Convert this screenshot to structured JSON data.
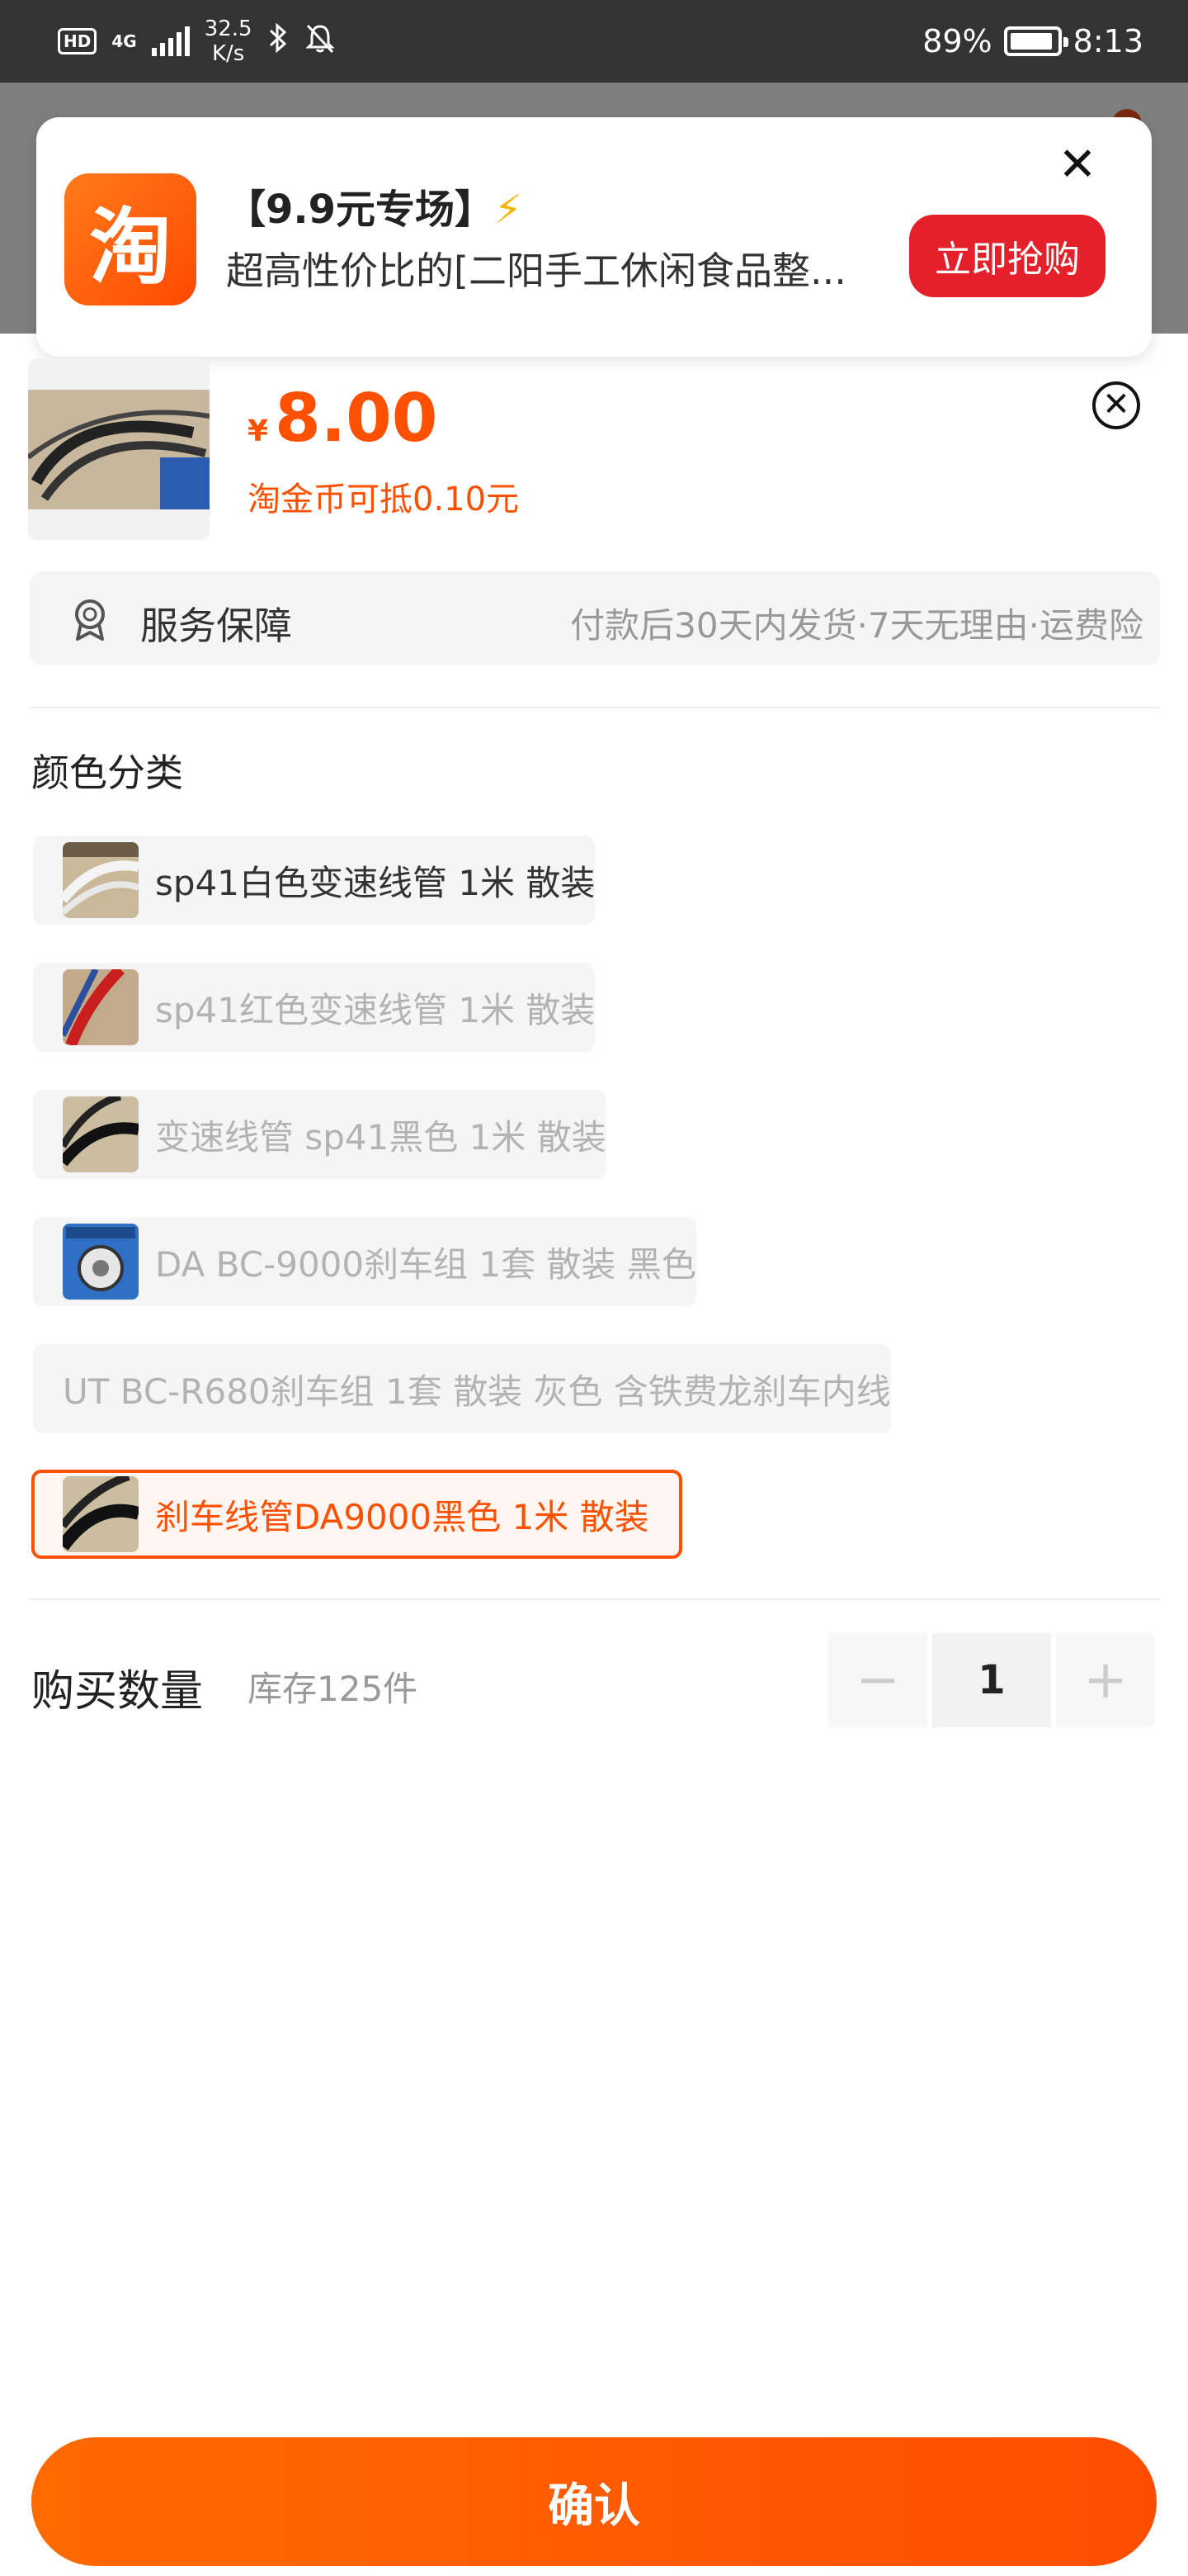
{
  "status_bar": {
    "hd": "HD",
    "network": "4G",
    "speed_value": "32.5",
    "speed_unit": "K/s",
    "battery": "89%",
    "time": "8:13"
  },
  "notification": {
    "app_icon_char": "淘",
    "title": "【9.9元专场】",
    "title_icon": "lightning-icon",
    "text": "超高性价比的[二阳手工休闲食品整...",
    "button_label": "立即抢购",
    "close_icon": "close-icon"
  },
  "product": {
    "currency": "¥",
    "price": "8.00",
    "coin_note": "淘金币可抵0.10元"
  },
  "service": {
    "icon": "badge-icon",
    "label": "服务保障",
    "desc": "付款后30天内发货·7天无理由·运费险"
  },
  "variants": {
    "title": "颜色分类",
    "items": [
      {
        "label": "sp41白色变速线管 1米 散装",
        "state": "normal"
      },
      {
        "label": "sp41红色变速线管 1米 散装",
        "state": "disabled"
      },
      {
        "label": "变速线管 sp41黑色 1米 散装",
        "state": "disabled"
      },
      {
        "label": "DA BC-9000刹车组 1套 散装 黑色",
        "state": "disabled"
      },
      {
        "label": "UT BC-R680刹车组 1套 散装 灰色 含铁费龙刹车内线",
        "state": "disabled"
      },
      {
        "label": "刹车线管DA9000黑色 1米 散装",
        "state": "selected"
      }
    ]
  },
  "quantity": {
    "label": "购买数量",
    "stock": "库存125件",
    "value": "1",
    "minus": "−",
    "plus": "+"
  },
  "confirm_label": "确认",
  "colors": {
    "accent": "#ff5000",
    "banner_button": "#e4202a"
  }
}
